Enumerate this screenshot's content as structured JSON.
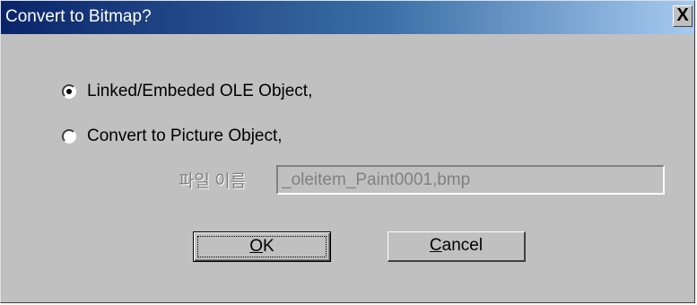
{
  "window": {
    "title": "Convert to Bitmap?",
    "close_glyph": "X"
  },
  "options": [
    {
      "label": "Linked/Embeded OLE Object,",
      "selected": true
    },
    {
      "label": "Convert to Picture Object,",
      "selected": false
    }
  ],
  "filename": {
    "label": "파일 이름",
    "value": "_oleitem_Paint0001,bmp",
    "enabled": false
  },
  "buttons": {
    "ok": {
      "mnemonic": "O",
      "rest": "K"
    },
    "cancel": {
      "mnemonic": "C",
      "rest": "ancel"
    }
  },
  "colors": {
    "dialog_bg": "#c0c0c0",
    "titlebar_start": "#0a246a",
    "titlebar_end": "#a6caf0",
    "disabled_text": "#808080"
  }
}
